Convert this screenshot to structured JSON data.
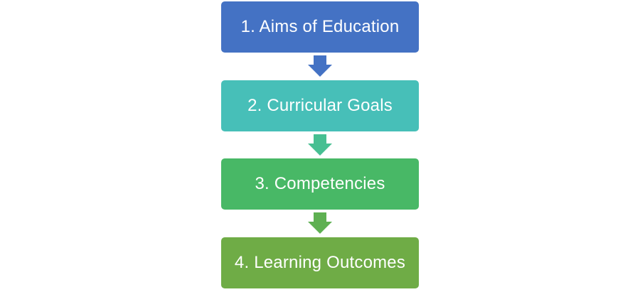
{
  "steps": [
    {
      "label": "1. Aims of Education",
      "color": "#4472C4"
    },
    {
      "label": "2. Curricular Goals",
      "color": "#47BFB8"
    },
    {
      "label": "3. Competencies",
      "color": "#48B866"
    },
    {
      "label": "4. Learning Outcomes",
      "color": "#6FAC46"
    }
  ],
  "arrows": [
    {
      "icon": "down-arrow-icon",
      "color": "#4472C4"
    },
    {
      "icon": "down-arrow-icon",
      "color": "#47BF92"
    },
    {
      "icon": "down-arrow-icon",
      "color": "#5EB052"
    }
  ]
}
